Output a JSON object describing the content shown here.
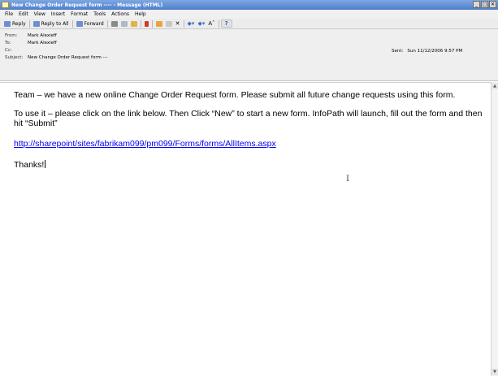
{
  "window": {
    "title": "New Change Order Request form ---- - Message (HTML)",
    "minimize": "_",
    "maximize": "□",
    "close": "✕"
  },
  "menu": [
    "File",
    "Edit",
    "View",
    "Insert",
    "Format",
    "Tools",
    "Actions",
    "Help"
  ],
  "toolbar": {
    "reply": "Reply",
    "reply_all": "Reply to All",
    "forward": "Forward",
    "icons": [
      "print-icon",
      "copy-icon",
      "move-to-folder-icon",
      "flag-icon",
      "categorize-icon",
      "move-icon",
      "delete-icon",
      "previous-icon",
      "next-icon",
      "font-size-icon",
      "help-icon"
    ],
    "font_size_glyph": "Aˆ",
    "help_glyph": "?"
  },
  "header": {
    "from_label": "From:",
    "from_value": "Mark Alexieff",
    "to_label": "To:",
    "to_value": "Mark Alexieff",
    "cc_label": "Cc:",
    "cc_value": "",
    "subject_label": "Subject:",
    "subject_value": "New Change Order Request form ---",
    "sent_label": "Sent:",
    "sent_value": "Sun 11/12/2006 9:57 PM"
  },
  "body": {
    "line1": "Team – we have a new online Change Order Request form.  Please submit all future change requests using this form.",
    "line2": "To use it – please click on the link below.  Then Click “New” to start a new form.  InfoPath will launch, fill out the form and then hit “Submit”",
    "link": "http://sharepoint/sites/fabrikam099/pm099/Forms/forms/AllItems.aspx",
    "closing": "Thanks!"
  },
  "colors": {
    "title_bar": "#4f7fcb",
    "link": "#0000ee",
    "header_bg": "#efefef"
  }
}
